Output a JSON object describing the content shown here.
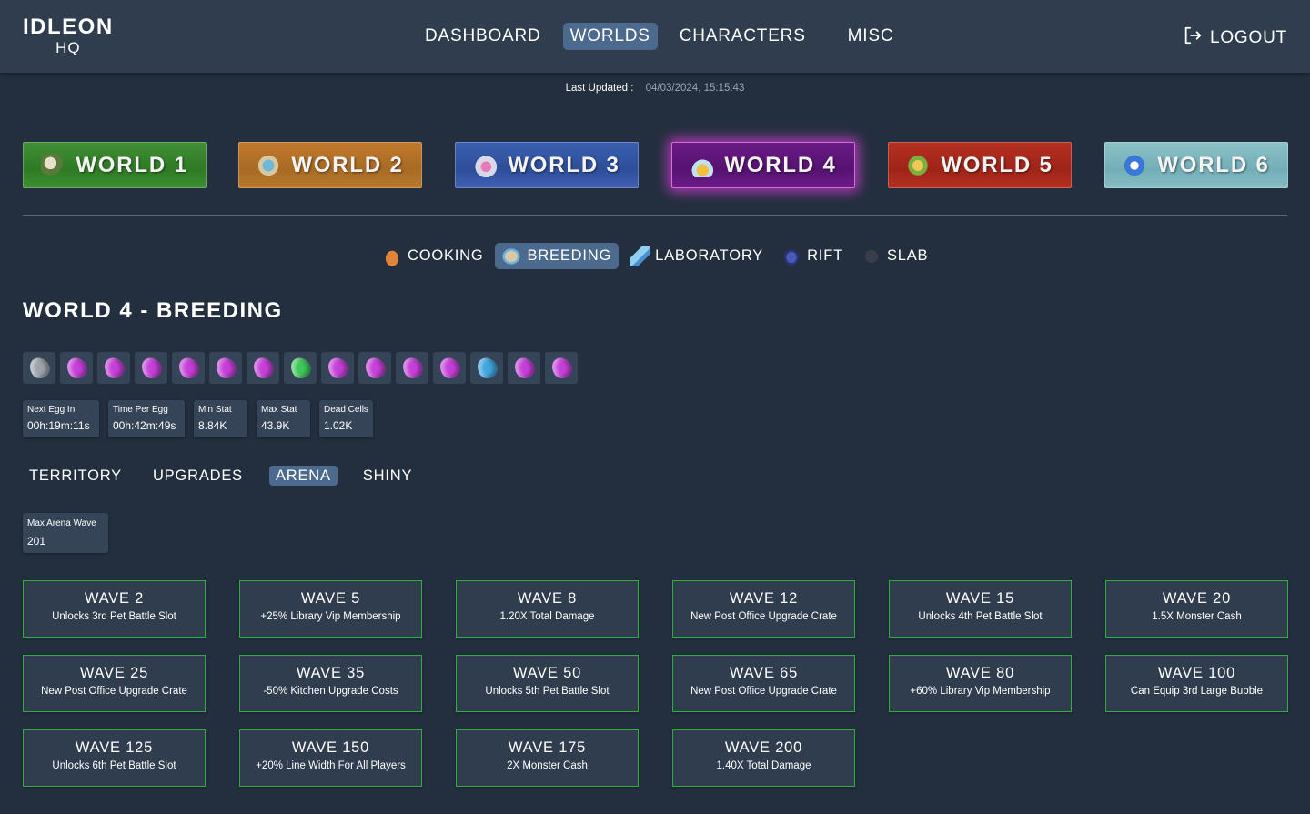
{
  "logo": {
    "line1": "IDLEON",
    "line2": "HQ"
  },
  "nav": {
    "items": [
      {
        "label": "DASHBOARD",
        "active": false
      },
      {
        "label": "WORLDS",
        "active": true
      },
      {
        "label": "CHARACTERS",
        "active": false
      },
      {
        "label": "MISC",
        "active": false
      }
    ],
    "logout_label": "LOGOUT"
  },
  "last_updated": {
    "label": "Last Updated :",
    "value": "04/03/2024, 15:15:43"
  },
  "worlds": [
    {
      "label": "WORLD 1",
      "icon": "world-1-icon"
    },
    {
      "label": "WORLD 2",
      "icon": "world-2-icon"
    },
    {
      "label": "WORLD 3",
      "icon": "world-3-icon"
    },
    {
      "label": "WORLD 4",
      "icon": "world-4-icon",
      "active": true
    },
    {
      "label": "WORLD 5",
      "icon": "world-5-icon"
    },
    {
      "label": "WORLD 6",
      "icon": "world-6-icon"
    }
  ],
  "subnav": [
    {
      "label": "COOKING",
      "icon": "cooking-icon"
    },
    {
      "label": "BREEDING",
      "icon": "breeding-icon",
      "active": true
    },
    {
      "label": "LABORATORY",
      "icon": "laboratory-icon"
    },
    {
      "label": "RIFT",
      "icon": "rift-icon"
    },
    {
      "label": "SLAB",
      "icon": "slab-icon"
    }
  ],
  "page_title": "WORLD 4 - BREEDING",
  "eggs": [
    {
      "color": "#9da3ab"
    },
    {
      "color": "#c53fd8"
    },
    {
      "color": "#c53fd8"
    },
    {
      "color": "#c53fd8"
    },
    {
      "color": "#c53fd8"
    },
    {
      "color": "#c53fd8"
    },
    {
      "color": "#c53fd8"
    },
    {
      "color": "#3fc85a"
    },
    {
      "color": "#c53fd8"
    },
    {
      "color": "#c53fd8"
    },
    {
      "color": "#c53fd8"
    },
    {
      "color": "#c53fd8"
    },
    {
      "color": "#3fa6e0"
    },
    {
      "color": "#c53fd8"
    },
    {
      "color": "#c53fd8"
    }
  ],
  "stats": [
    {
      "label": "Next Egg In",
      "value": "00h:19m:11s"
    },
    {
      "label": "Time Per Egg",
      "value": "00h:42m:49s"
    },
    {
      "label": "Min Stat",
      "value": "8.84K"
    },
    {
      "label": "Max Stat",
      "value": "43.9K"
    },
    {
      "label": "Dead Cells",
      "value": "1.02K"
    }
  ],
  "tabs": [
    {
      "label": "TERRITORY",
      "active": false
    },
    {
      "label": "UPGRADES",
      "active": false
    },
    {
      "label": "ARENA",
      "active": true
    },
    {
      "label": "SHINY",
      "active": false
    }
  ],
  "arena": {
    "label": "Max Arena Wave",
    "value": "201"
  },
  "waves": [
    {
      "title": "WAVE 2",
      "desc": "Unlocks 3rd Pet Battle Slot"
    },
    {
      "title": "WAVE 5",
      "desc": "+25% Library Vip Membership"
    },
    {
      "title": "WAVE 8",
      "desc": "1.20X Total Damage"
    },
    {
      "title": "WAVE 12",
      "desc": "New Post Office Upgrade Crate"
    },
    {
      "title": "WAVE 15",
      "desc": "Unlocks 4th Pet Battle Slot"
    },
    {
      "title": "WAVE 20",
      "desc": "1.5X Monster Cash"
    },
    {
      "title": "WAVE 25",
      "desc": "New Post Office Upgrade Crate"
    },
    {
      "title": "WAVE 35",
      "desc": "-50% Kitchen Upgrade Costs"
    },
    {
      "title": "WAVE 50",
      "desc": "Unlocks 5th Pet Battle Slot"
    },
    {
      "title": "WAVE 65",
      "desc": "New Post Office Upgrade Crate"
    },
    {
      "title": "WAVE 80",
      "desc": "+60% Library Vip Membership"
    },
    {
      "title": "WAVE 100",
      "desc": "Can Equip 3rd Large Bubble"
    },
    {
      "title": "WAVE 125",
      "desc": "Unlocks 6th Pet Battle Slot"
    },
    {
      "title": "WAVE 150",
      "desc": "+20% Line Width For All Players"
    },
    {
      "title": "WAVE 175",
      "desc": "2X Monster Cash"
    },
    {
      "title": "WAVE 200",
      "desc": "1.40X Total Damage"
    }
  ],
  "colors": {
    "background": "#232f3e",
    "header": "#2f3d4e",
    "active_pill": "#4b6a8e",
    "wave_border": "#2fae3d"
  }
}
